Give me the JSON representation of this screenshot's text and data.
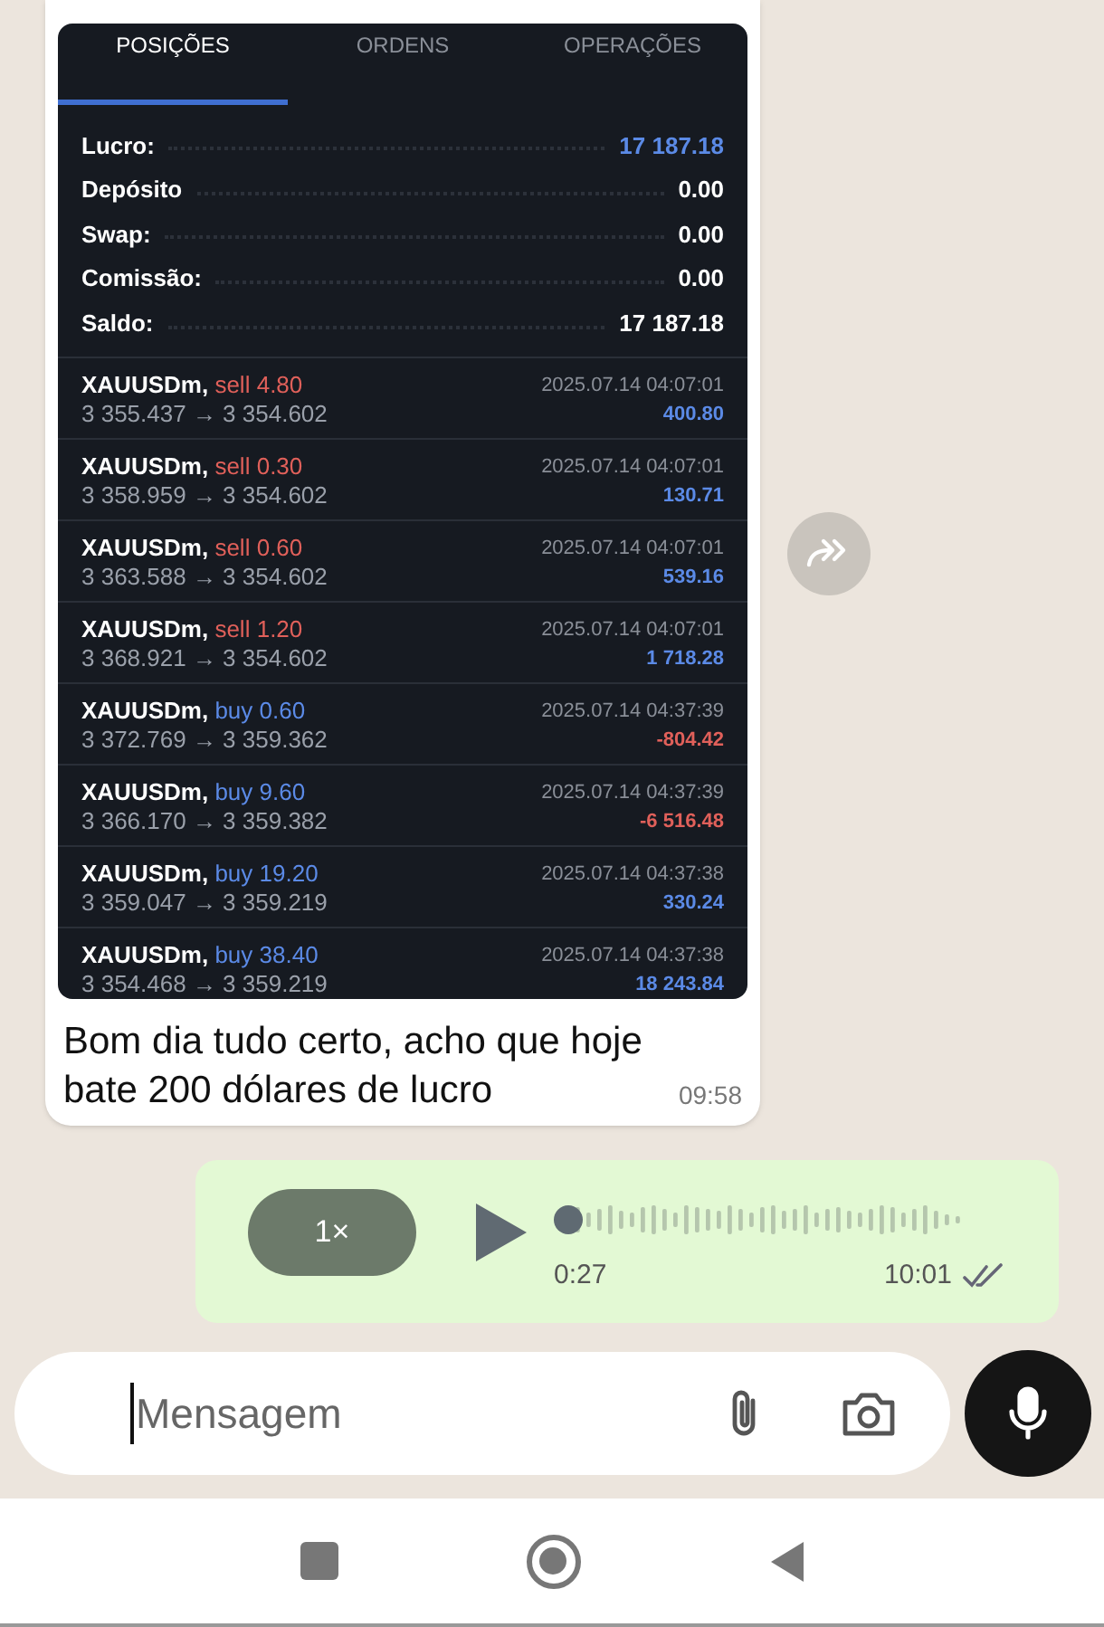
{
  "message": {
    "screenshot": {
      "tabs": [
        {
          "label": "POSIÇÕES",
          "selected": true
        },
        {
          "label": "ORDENS",
          "selected": false
        },
        {
          "label": "OPERAÇÕES",
          "selected": false
        }
      ],
      "summary": [
        {
          "label": "Lucro:",
          "value": "17 187.18",
          "highlight": true
        },
        {
          "label": "Depósito",
          "value": "0.00",
          "highlight": false
        },
        {
          "label": "Swap:",
          "value": "0.00",
          "highlight": false
        },
        {
          "label": "Comissão:",
          "value": "0.00",
          "highlight": false
        },
        {
          "label": "Saldo:",
          "value": "17 187.18",
          "highlight": false
        }
      ],
      "trades": [
        {
          "symbol": "XAUUSDm,",
          "side": "sell",
          "amount": "4.80",
          "prices": "3 355.437 → 3 354.602",
          "time": "2025.07.14 04:07:01",
          "profit": "400.80",
          "negative": false
        },
        {
          "symbol": "XAUUSDm,",
          "side": "sell",
          "amount": "0.30",
          "prices": "3 358.959 → 3 354.602",
          "time": "2025.07.14 04:07:01",
          "profit": "130.71",
          "negative": false
        },
        {
          "symbol": "XAUUSDm,",
          "side": "sell",
          "amount": "0.60",
          "prices": "3 363.588 → 3 354.602",
          "time": "2025.07.14 04:07:01",
          "profit": "539.16",
          "negative": false
        },
        {
          "symbol": "XAUUSDm,",
          "side": "sell",
          "amount": "1.20",
          "prices": "3 368.921 → 3 354.602",
          "time": "2025.07.14 04:07:01",
          "profit": "1 718.28",
          "negative": false
        },
        {
          "symbol": "XAUUSDm,",
          "side": "buy",
          "amount": "0.60",
          "prices": "3 372.769 → 3 359.362",
          "time": "2025.07.14 04:37:39",
          "profit": "-804.42",
          "negative": true
        },
        {
          "symbol": "XAUUSDm,",
          "side": "buy",
          "amount": "9.60",
          "prices": "3 366.170 → 3 359.382",
          "time": "2025.07.14 04:37:39",
          "profit": "-6 516.48",
          "negative": true
        },
        {
          "symbol": "XAUUSDm,",
          "side": "buy",
          "amount": "19.20",
          "prices": "3 359.047 → 3 359.219",
          "time": "2025.07.14 04:37:38",
          "profit": "330.24",
          "negative": false
        },
        {
          "symbol": "XAUUSDm,",
          "side": "buy",
          "amount": "38.40",
          "prices": "3 354.468 → 3 359.219",
          "time": "2025.07.14 04:37:38",
          "profit": "18 243.84",
          "negative": false
        }
      ]
    },
    "text": "Bom dia tudo certo, acho que hoje bate 200 dólares de lucro",
    "time": "09:58"
  },
  "voice_message": {
    "speed": "1×",
    "duration": "0:27",
    "time": "10:01",
    "read": false
  },
  "composer": {
    "placeholder": "Mensagem"
  }
}
